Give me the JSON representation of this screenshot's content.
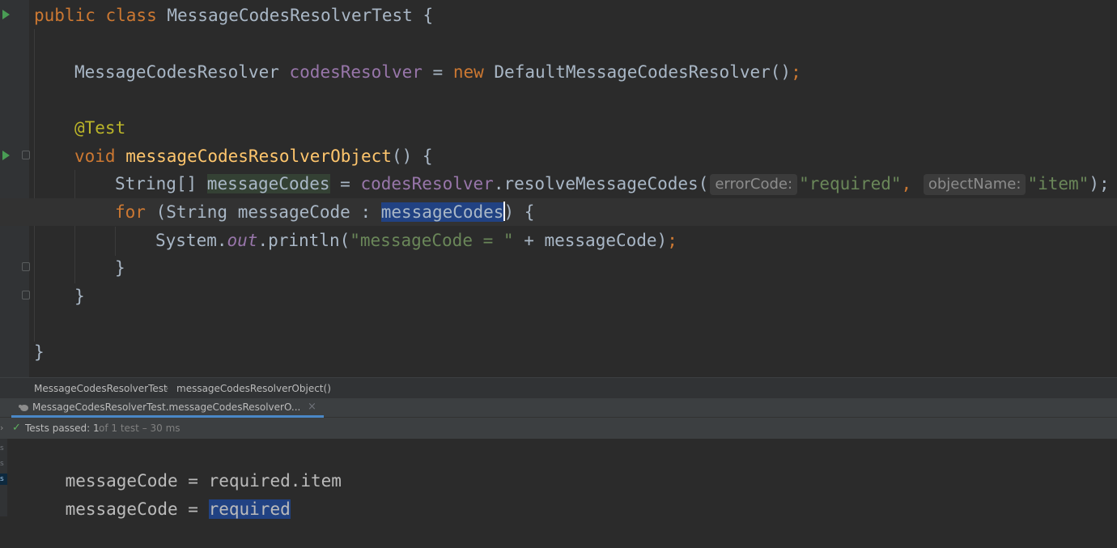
{
  "editor": {
    "lines": [
      {
        "segments": [
          {
            "text": "public class ",
            "cls": "kw"
          },
          {
            "text": "MessageCodesResolverTest {",
            "cls": ""
          }
        ]
      },
      {
        "segments": [
          {
            "text": "MessageCodesResolver ",
            "cls": ""
          },
          {
            "text": "codesResolver",
            "cls": "fld"
          },
          {
            "text": " = ",
            "cls": ""
          },
          {
            "text": "new ",
            "cls": "kw"
          },
          {
            "text": "DefaultMessageCodesResolver()",
            "cls": ""
          },
          {
            "text": ";",
            "cls": "kw"
          }
        ]
      },
      {
        "segments": [
          {
            "text": "@Test",
            "cls": "ann"
          }
        ]
      },
      {
        "segments": [
          {
            "text": "void ",
            "cls": "kw"
          },
          {
            "text": "messageCodesResolverObject",
            "cls": "fn"
          },
          {
            "text": "() {",
            "cls": ""
          }
        ]
      },
      {
        "segments": [
          {
            "text": "String[] ",
            "cls": ""
          },
          {
            "text": "messageCodes",
            "cls": "uline"
          },
          {
            "text": " = ",
            "cls": ""
          },
          {
            "text": "codesResolver",
            "cls": "fld"
          },
          {
            "text": ".resolveMessageCodes(",
            "cls": ""
          },
          {
            "text": "errorCode:",
            "cls": "hint"
          },
          {
            "text": "\"required\"",
            "cls": "str"
          },
          {
            "text": ", ",
            "cls": "kw"
          },
          {
            "text": "objectName:",
            "cls": "hint"
          },
          {
            "text": "\"item\"",
            "cls": "str"
          },
          {
            "text": ");",
            "cls": ""
          }
        ]
      },
      {
        "segments": [
          {
            "text": "for ",
            "cls": "kw"
          },
          {
            "text": "(String messageCode : ",
            "cls": ""
          },
          {
            "text": "messageCodes",
            "cls": "sel"
          },
          {
            "text": "",
            "cls": "caret"
          },
          {
            "text": ") {",
            "cls": ""
          }
        ]
      },
      {
        "segments": [
          {
            "text": "System.",
            "cls": ""
          },
          {
            "text": "out",
            "cls": "fld it"
          },
          {
            "text": ".println(",
            "cls": ""
          },
          {
            "text": "\"messageCode = \"",
            "cls": "str"
          },
          {
            "text": " + messageCode)",
            "cls": ""
          },
          {
            "text": ";",
            "cls": "kw"
          }
        ]
      },
      {
        "segments": [
          {
            "text": "}",
            "cls": ""
          }
        ]
      },
      {
        "segments": [
          {
            "text": "}",
            "cls": ""
          }
        ]
      },
      {
        "segments": [
          {
            "text": "}",
            "cls": ""
          }
        ]
      }
    ]
  },
  "breadcrumb": {
    "items": [
      "MessageCodesResolverTest",
      "messageCodesResolverObject()"
    ],
    "separator": "›"
  },
  "run": {
    "tab_label": "MessageCodesResolverTest.messageCodesResolverO...",
    "tab_close": "×",
    "status_prefix": "Tests passed: 1",
    "status_suffix": "of 1 test – 30 ms",
    "check_symbol": "✓",
    "expand_symbol": "›",
    "strip_letters": [
      "s",
      "s",
      "s"
    ],
    "console_lines": [
      {
        "prefix": "messageCode = ",
        "value": "required.item",
        "selected": false
      },
      {
        "prefix": "messageCode = ",
        "value": "required",
        "selected": true
      }
    ]
  },
  "colors": {
    "editor_bg": "#2b2b2b",
    "keyword": "#cc7832",
    "field": "#9876aa",
    "method": "#ffc66d",
    "string": "#6a8759",
    "annotation": "#bbb529",
    "selection": "#214283",
    "run_icon": "#499c54",
    "pass_check": "#5fb05f",
    "tab_underline": "#4a88c7"
  },
  "icons": {
    "run": "run-gutter-icon",
    "fold": "fold-icon",
    "bulb": "intention-bulb-icon",
    "test_tab": "test-run-icon",
    "check": "check-icon"
  }
}
